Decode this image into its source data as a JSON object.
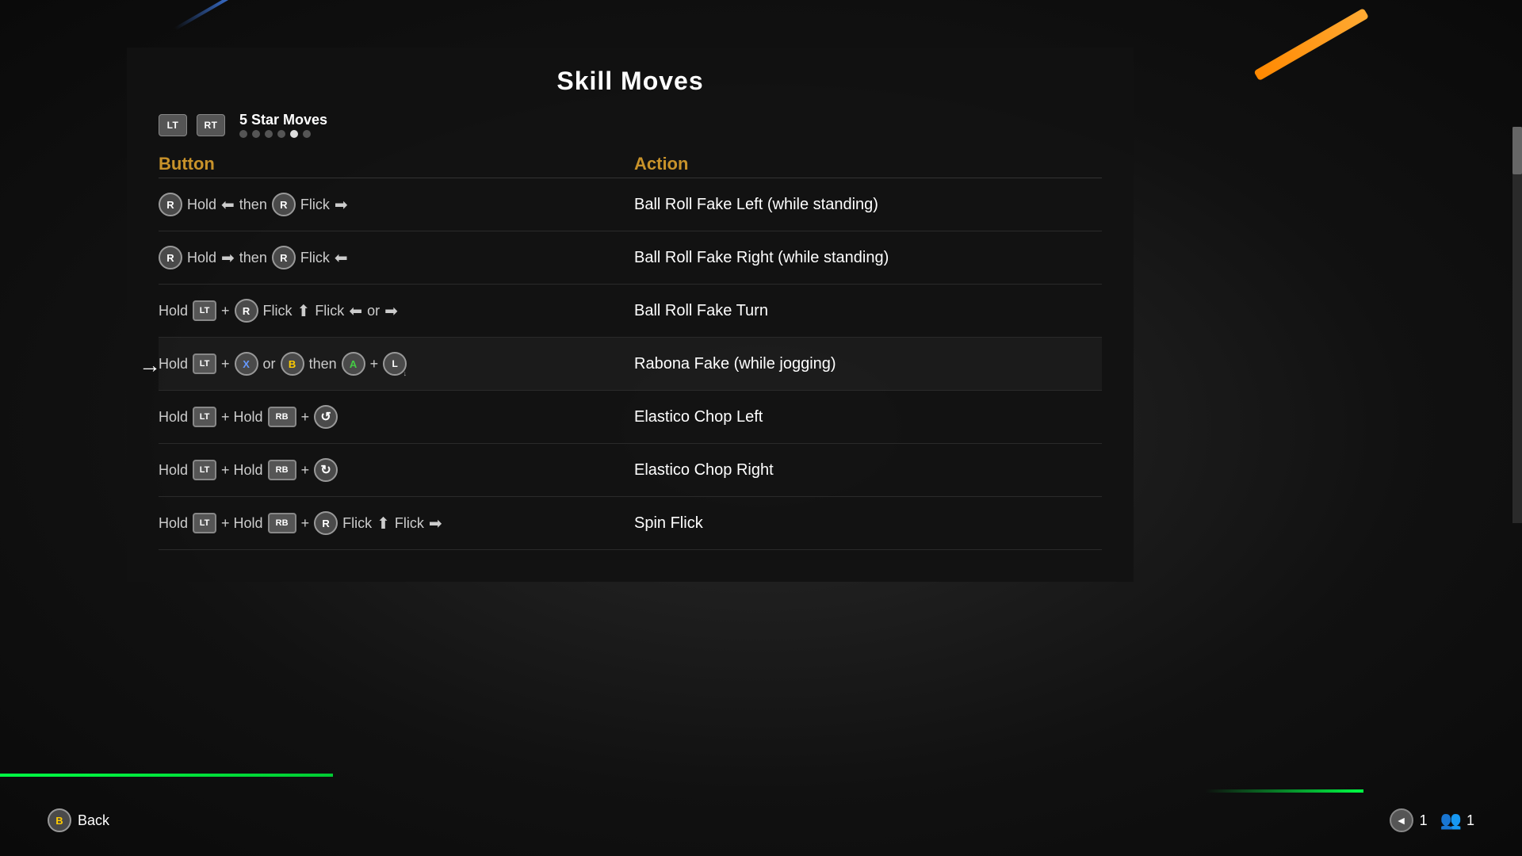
{
  "page": {
    "title": "Skill Moves",
    "background": {
      "base": "#1a1a1a"
    }
  },
  "tabs": {
    "lt_label": "LT",
    "rt_label": "RT",
    "title": "5 Star Moves",
    "dots": [
      {
        "active": false
      },
      {
        "active": false
      },
      {
        "active": false
      },
      {
        "active": false
      },
      {
        "active": true
      },
      {
        "active": false
      }
    ]
  },
  "columns": {
    "button_header": "Button",
    "action_header": "Action"
  },
  "moves": [
    {
      "id": 1,
      "highlighted": false,
      "button_parts": "R Hold ← then R Flick →",
      "action": "Ball Roll Fake Left (while standing)"
    },
    {
      "id": 2,
      "highlighted": false,
      "button_parts": "R Hold → then R Flick ←",
      "action": "Ball Roll Fake Right (while standing)"
    },
    {
      "id": 3,
      "highlighted": false,
      "button_parts": "Hold LT + R Flick ↑ Flick ← or →",
      "action": "Ball Roll Fake Turn"
    },
    {
      "id": 4,
      "highlighted": true,
      "button_parts": "Hold LT + X or B then A + L",
      "action": "Rabona Fake (while jogging)"
    },
    {
      "id": 5,
      "highlighted": false,
      "button_parts": "Hold LT + Hold RB + R (spin left)",
      "action": "Elastico Chop Left"
    },
    {
      "id": 6,
      "highlighted": false,
      "button_parts": "Hold LT + Hold RB + R (spin right)",
      "action": "Elastico Chop Right"
    },
    {
      "id": 7,
      "highlighted": false,
      "button_parts": "Hold LT + Hold RB + R Flick ↑ Flick →",
      "action": "Spin Flick"
    }
  ],
  "bottom": {
    "back_label": "Back",
    "b_btn": "B",
    "page_num": "1",
    "players_num": "1",
    "nav_left": "◄"
  }
}
